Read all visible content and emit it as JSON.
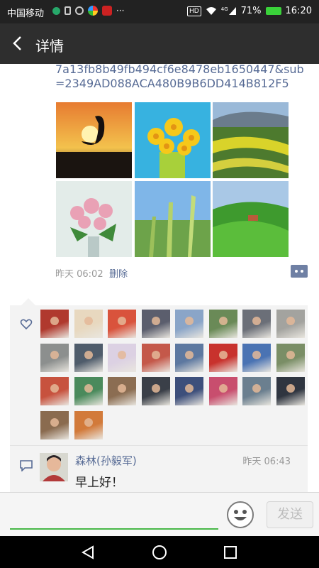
{
  "status": {
    "carrier": "中国移动",
    "battery": "71%",
    "time": "16:20",
    "hd": "HD",
    "network": "4G"
  },
  "header": {
    "title": "详情",
    "back_icon": "chevron-left-icon"
  },
  "post": {
    "link_text": "7a13fb8b49fb494cf6e8478eb1650447&sub=2349AD088ACA480B9B6DD414B812F5",
    "time": "昨天 06:02",
    "delete_label": "删除",
    "images": [
      "crane-sunset",
      "yellow-daisies",
      "terraced-fields",
      "pink-roses",
      "wheat-ears",
      "green-hills"
    ]
  },
  "likes": {
    "icon": "heart-icon",
    "avatars": [
      "#b0392e",
      "#e8d8bf",
      "#d9533c",
      "#5b5e6d",
      "#8aa5c8",
      "#6a8a57",
      "#6b6f78",
      "#a3a39f",
      "#8c8f8e",
      "#4f5c6b",
      "#dcd1e3",
      "#c4584a",
      "#5d78a0",
      "#c8322d",
      "#4a73b3",
      "#7a8e66",
      "#c7523e",
      "#4a8a5c",
      "#8b6d52",
      "#3a3f48",
      "#3d4f7b",
      "#c84e6e",
      "#6b7f8f",
      "#2f3540",
      "#8a6b4f",
      "#d27a3a"
    ]
  },
  "comment": {
    "icon": "comment-icon",
    "name": "森林(孙毅军)",
    "time": "昨天 06:43",
    "text": "早上好！"
  },
  "input": {
    "placeholder": "",
    "emoji_icon": "smiley-icon",
    "send_label": "发送"
  },
  "nav": {
    "back": "triangle-back-icon",
    "home": "circle-home-icon",
    "recent": "square-recent-icon"
  }
}
